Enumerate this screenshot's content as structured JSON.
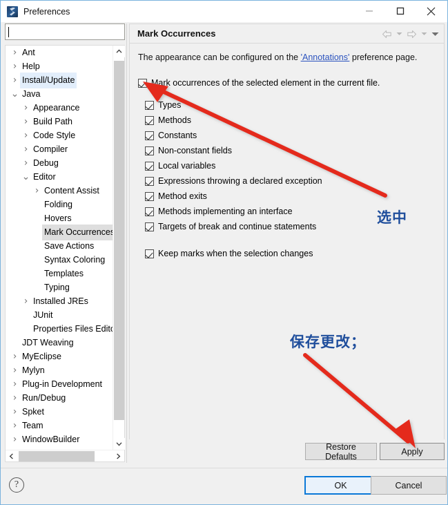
{
  "window": {
    "title": "Preferences",
    "app_icon": "myeclipse-icon",
    "controls": {
      "minimize": "minimize-icon",
      "maximize": "maximize-icon",
      "close": "close-icon"
    },
    "border_color": "#7ab3dd"
  },
  "filter": {
    "value": "",
    "placeholder": ""
  },
  "tree": {
    "items": [
      {
        "label": "Ant",
        "indent": 0,
        "arrow": "collapsed",
        "state": "normal"
      },
      {
        "label": "Help",
        "indent": 0,
        "arrow": "collapsed",
        "state": "normal"
      },
      {
        "label": "Install/Update",
        "indent": 0,
        "arrow": "collapsed",
        "state": "highlight-blue"
      },
      {
        "label": "Java",
        "indent": 0,
        "arrow": "expanded",
        "state": "normal"
      },
      {
        "label": "Appearance",
        "indent": 1,
        "arrow": "collapsed",
        "state": "normal"
      },
      {
        "label": "Build Path",
        "indent": 1,
        "arrow": "collapsed",
        "state": "normal"
      },
      {
        "label": "Code Style",
        "indent": 1,
        "arrow": "collapsed",
        "state": "normal"
      },
      {
        "label": "Compiler",
        "indent": 1,
        "arrow": "collapsed",
        "state": "normal"
      },
      {
        "label": "Debug",
        "indent": 1,
        "arrow": "collapsed",
        "state": "normal"
      },
      {
        "label": "Editor",
        "indent": 1,
        "arrow": "expanded",
        "state": "normal"
      },
      {
        "label": "Content Assist",
        "indent": 2,
        "arrow": "collapsed",
        "state": "normal"
      },
      {
        "label": "Folding",
        "indent": 2,
        "arrow": "none",
        "state": "normal"
      },
      {
        "label": "Hovers",
        "indent": 2,
        "arrow": "none",
        "state": "normal"
      },
      {
        "label": "Mark Occurrences",
        "indent": 2,
        "arrow": "none",
        "state": "selected-gray"
      },
      {
        "label": "Save Actions",
        "indent": 2,
        "arrow": "none",
        "state": "normal"
      },
      {
        "label": "Syntax Coloring",
        "indent": 2,
        "arrow": "none",
        "state": "normal"
      },
      {
        "label": "Templates",
        "indent": 2,
        "arrow": "none",
        "state": "normal"
      },
      {
        "label": "Typing",
        "indent": 2,
        "arrow": "none",
        "state": "normal"
      },
      {
        "label": "Installed JREs",
        "indent": 1,
        "arrow": "collapsed",
        "state": "normal"
      },
      {
        "label": "JUnit",
        "indent": 1,
        "arrow": "none",
        "state": "normal"
      },
      {
        "label": "Properties Files Editor",
        "indent": 1,
        "arrow": "none",
        "state": "normal"
      },
      {
        "label": "JDT Weaving",
        "indent": 0,
        "arrow": "none",
        "state": "normal"
      },
      {
        "label": "MyEclipse",
        "indent": 0,
        "arrow": "collapsed",
        "state": "normal"
      },
      {
        "label": "Mylyn",
        "indent": 0,
        "arrow": "collapsed",
        "state": "normal"
      },
      {
        "label": "Plug-in Development",
        "indent": 0,
        "arrow": "collapsed",
        "state": "normal"
      },
      {
        "label": "Run/Debug",
        "indent": 0,
        "arrow": "collapsed",
        "state": "normal"
      },
      {
        "label": "Spket",
        "indent": 0,
        "arrow": "collapsed",
        "state": "normal"
      },
      {
        "label": "Team",
        "indent": 0,
        "arrow": "collapsed",
        "state": "normal"
      },
      {
        "label": "WindowBuilder",
        "indent": 0,
        "arrow": "collapsed",
        "state": "normal"
      }
    ],
    "scroll_up": "chevron-up-icon",
    "scroll_down": "chevron-down-icon",
    "scroll_left": "chevron-left-icon",
    "scroll_right": "chevron-right-icon"
  },
  "page": {
    "title": "Mark Occurrences",
    "toolbar": {
      "back": "back-arrow-icon",
      "back_menu": "chevron-down-icon",
      "forward": "forward-arrow-icon",
      "forward_menu": "chevron-down-icon",
      "view_menu": "chevron-down-filled-icon"
    },
    "description": {
      "before": "The appearance can be configured on the ",
      "link": "'Annotations'",
      "after": " preference page."
    },
    "master_checkbox": {
      "label": "Mark occurrences of the selected element in the current file.",
      "checked": true
    },
    "options": [
      {
        "label": "Types",
        "checked": true
      },
      {
        "label": "Methods",
        "checked": true
      },
      {
        "label": "Constants",
        "checked": true
      },
      {
        "label": "Non-constant fields",
        "checked": true
      },
      {
        "label": "Local variables",
        "checked": true
      },
      {
        "label": "Expressions throwing a declared exception",
        "checked": true
      },
      {
        "label": "Method exits",
        "checked": true
      },
      {
        "label": "Methods implementing an interface",
        "checked": true
      },
      {
        "label": "Targets of break and continue statements",
        "checked": true
      }
    ],
    "keep_marks": {
      "label": "Keep marks when the selection changes",
      "checked": true
    },
    "restore_defaults": "Restore Defaults",
    "apply": "Apply"
  },
  "annotations": {
    "color": "#1f4e9c",
    "arrow_color": "#e42a1b",
    "note_select": "选中",
    "note_save": "保存更改；"
  },
  "footer": {
    "help": "help-icon",
    "ok": "OK",
    "cancel": "Cancel"
  }
}
